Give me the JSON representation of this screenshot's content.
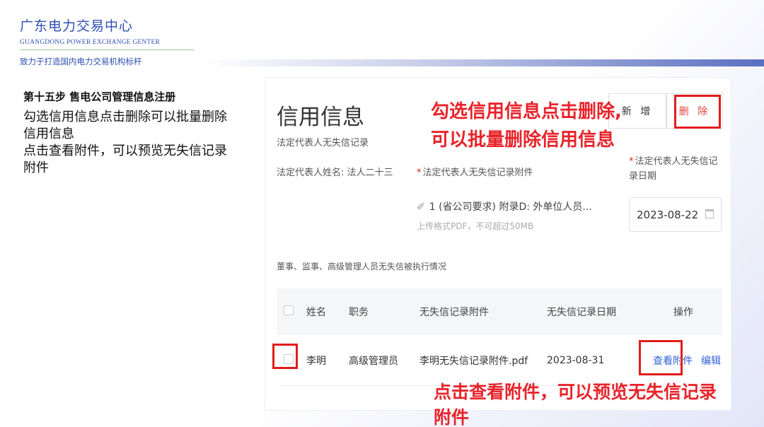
{
  "header": {
    "org_cn": "广东电力交易中心",
    "org_en": "GUANGDONG POWER EXCHANGE GENTER",
    "slogan": "致力于打造国内电力交易机构标杆"
  },
  "step": {
    "title": "第十五步 售电公司管理信息注册",
    "desc_lines": [
      "勾选信用信息点击删除可以批量删除",
      "信用信息",
      "点击查看附件，可以预览无失信记录",
      "附件"
    ]
  },
  "panel": {
    "title": "信用信息",
    "subtitle": "法定代表人无失信记录",
    "legal_name": "法定代表人姓名: 法人二十三",
    "required_mark": "*",
    "attach_label": "法定代表人无失信记录附件",
    "date_label": "法定代表人无失信记录日期",
    "file_name": "1 (省公司要求) 附录D: 外单位人员...",
    "upload_hint": "上传格式PDF，不可超过50MB",
    "date_value": "2023-08-22",
    "buttons": {
      "add": "新 增",
      "delete": "删 除"
    },
    "section_label": "董事、监事、高级管理人员无失信被执行情况",
    "table": {
      "columns": [
        "姓名",
        "职务",
        "无失信记录附件",
        "无失信记录日期",
        "操作"
      ],
      "rows": [
        {
          "name": "李明",
          "job": "高级管理员",
          "file": "李明无失信记录附件.pdf",
          "date": "2023-08-31",
          "view": "查看附件",
          "edit": "编辑"
        }
      ]
    }
  },
  "annotations": {
    "top_line1": "勾选信用信息点击删除,",
    "top_line2": "可以批量删除信用信息",
    "bottom": "点击查看附件，可以预览无失信记录附件"
  },
  "colors": {
    "brand_blue": "#2f4fb3",
    "annotation_red": "#e8232a",
    "link_blue": "#2f62d6"
  }
}
